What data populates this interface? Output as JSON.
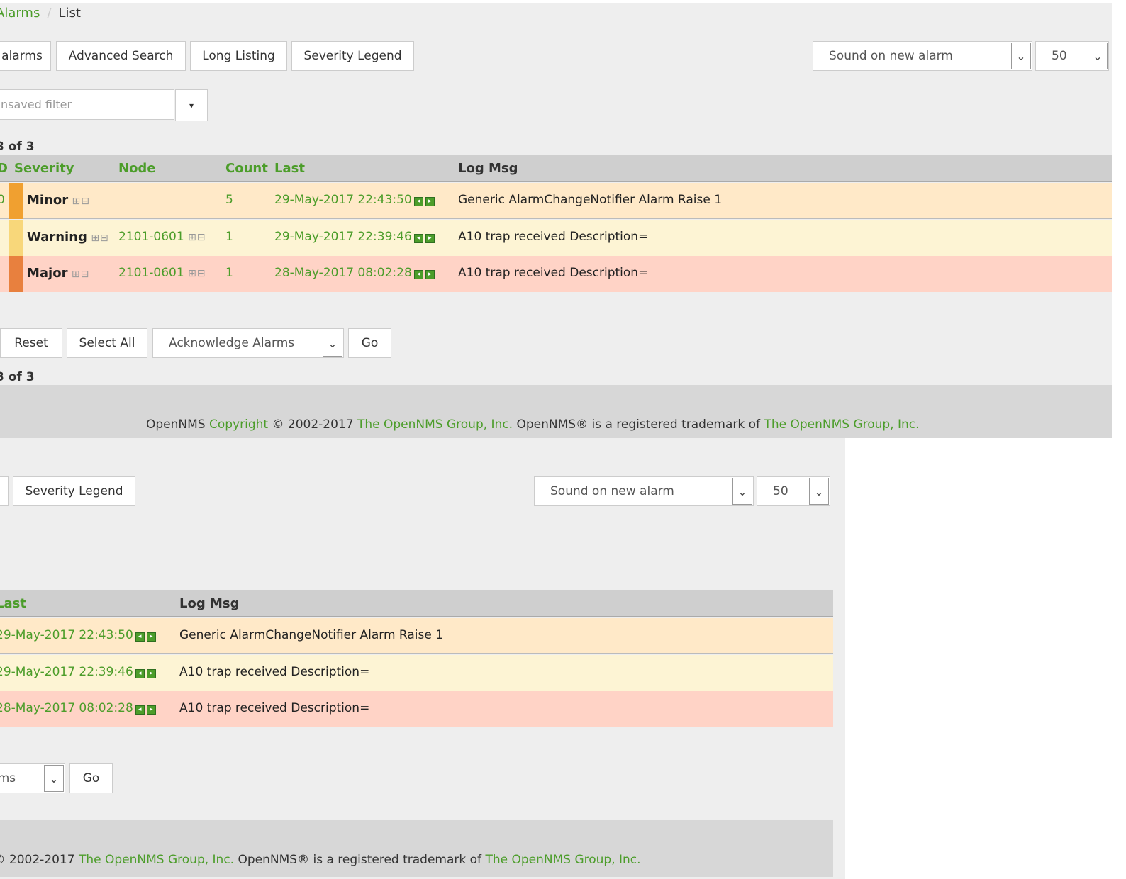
{
  "breadcrumb": {
    "parent": "Alarms",
    "separator": "/",
    "current": "List"
  },
  "toolbar": {
    "all_alarms": "alarms",
    "advanced_search": "Advanced Search",
    "long_listing": "Long Listing",
    "severity_legend": "Severity Legend",
    "sound_select": "Sound on new alarm",
    "limit_select": "50"
  },
  "filter": {
    "placeholder": "nsaved filter",
    "dropdown_caret": "▾"
  },
  "results_count": "3 of 3",
  "table": {
    "headers": {
      "id": "D",
      "severity": "Severity",
      "node": "Node",
      "count": "Count",
      "last": "Last",
      "logmsg": "Log Msg"
    },
    "rows": [
      {
        "id": "0",
        "severity": "Minor",
        "node": "",
        "count": "5",
        "last": "29-May-2017 22:43:50",
        "logmsg": "Generic AlarmChangeNotifier Alarm Raise 1",
        "color": "#f0a030"
      },
      {
        "id": "",
        "severity": "Warning",
        "node": "2101-0601",
        "count": "1",
        "last": "29-May-2017 22:39:46",
        "logmsg": "A10 trap received Description=",
        "color": "#f8d77a"
      },
      {
        "id": "",
        "severity": "Major",
        "node": "2101-0601",
        "count": "1",
        "last": "28-May-2017 08:02:28",
        "logmsg": "A10 trap received Description=",
        "color": "#e8803e"
      }
    ]
  },
  "actions": {
    "reset": "Reset",
    "select_all": "Select All",
    "action_select": "Acknowledge Alarms",
    "go": "Go"
  },
  "footer": {
    "prefix": "OpenNMS",
    "copyright_link": "Copyright",
    "years": "© 2002-2017",
    "group_link": "The OpenNMS Group, Inc.",
    "trademark_text": "OpenNMS® is a registered trademark of",
    "group_link2": "The OpenNMS Group, Inc."
  },
  "icons": {
    "plus_minus": "⊞⊟",
    "arrow_down": "⌄",
    "tbox_left": "◂",
    "tbox_right": "▸"
  },
  "colors": {
    "link": "#4c9d2a",
    "minor": "#f0a030",
    "warning": "#f8d77a",
    "major": "#e8803e"
  }
}
